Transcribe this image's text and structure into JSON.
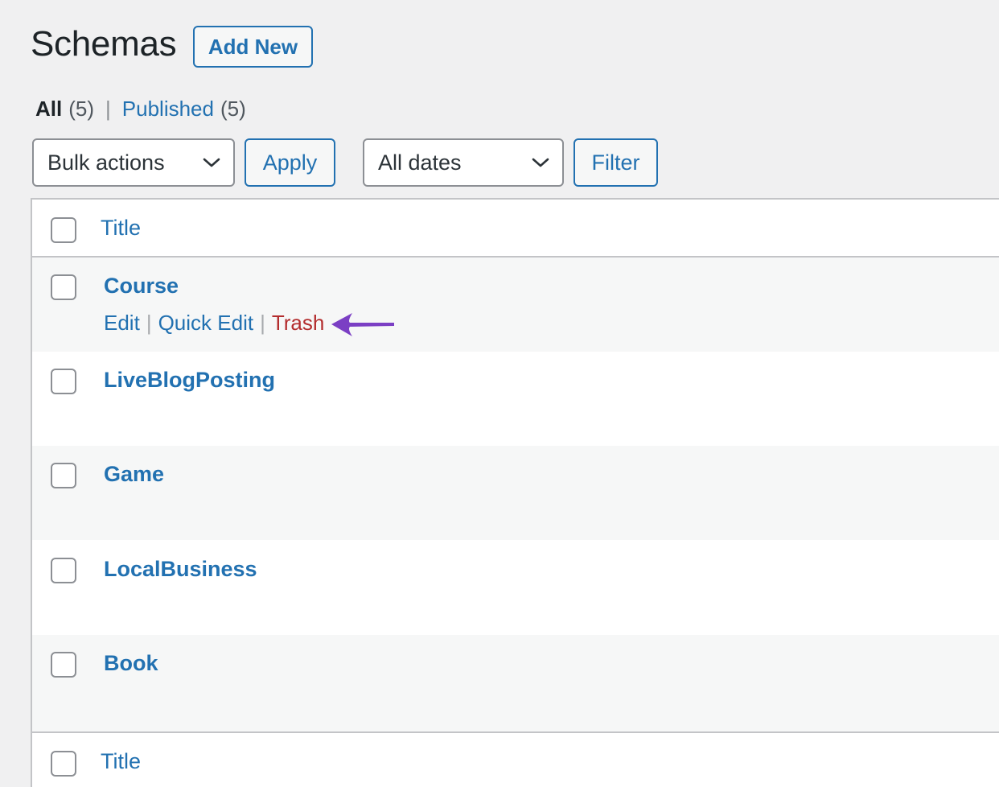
{
  "page": {
    "title": "Schemas",
    "add_new_label": "Add New"
  },
  "views": {
    "all_label": "All",
    "all_count": "(5)",
    "separator": "|",
    "published_label": "Published",
    "published_count": "(5)"
  },
  "controls": {
    "bulk_actions": "Bulk actions",
    "apply": "Apply",
    "dates": "All dates",
    "filter": "Filter"
  },
  "table": {
    "header_title": "Title",
    "footer_title": "Title",
    "rows": [
      {
        "title": "Course",
        "actions": {
          "edit": "Edit",
          "quick_edit": "Quick Edit",
          "trash": "Trash",
          "separator": "|"
        }
      },
      {
        "title": "LiveBlogPosting"
      },
      {
        "title": "Game"
      },
      {
        "title": "LocalBusiness"
      },
      {
        "title": "Book"
      }
    ]
  },
  "colors": {
    "link": "#2271b1",
    "trash": "#b32d2e",
    "annotation_arrow": "#7b3fc4"
  },
  "icons": {
    "select_chevron": "chevron-down-icon",
    "annotation": "arrow-left-icon"
  }
}
